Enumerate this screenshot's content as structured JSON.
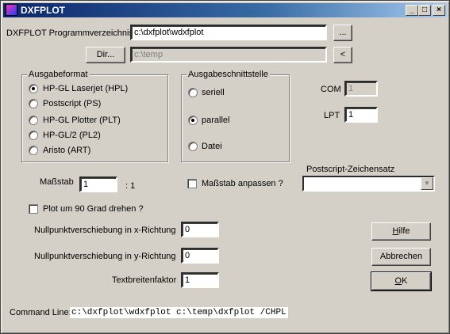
{
  "window": {
    "title": "DXFPLOT",
    "minimize": "_",
    "maximize": "□",
    "close": "×"
  },
  "program_dir": {
    "label": "DXFPLOT Programmverzeichnis",
    "value": "c:\\dxfplot\\wdxfplot",
    "browse": "..."
  },
  "dir": {
    "button": "Dir...",
    "value": "c:\\temp",
    "arrow": "<"
  },
  "output_format": {
    "title": "Ausgabeformat",
    "options": [
      "HP-GL Laserjet (HPL)",
      "Postscript (PS)",
      "HP-GL Plotter (PLT)",
      "HP-GL/2 (PL2)",
      "Aristo (ART)"
    ],
    "selected": 0
  },
  "interface": {
    "title": "Ausgabeschnittstelle",
    "options": [
      "seriell",
      "parallel",
      "Datei"
    ],
    "selected": 1
  },
  "com": {
    "label": "COM",
    "value": "1"
  },
  "lpt": {
    "label": "LPT",
    "value": "1"
  },
  "scale": {
    "label": "Maßstab",
    "value": "1",
    "suffix": ": 1"
  },
  "fit_scale": {
    "label": "Maßstab anpassen ?",
    "checked": false
  },
  "ps_font": {
    "label": "Postscript-Zeichensatz",
    "value": ""
  },
  "rotate": {
    "label": "Plot um 90 Grad drehen ?",
    "checked": false
  },
  "offset_x": {
    "label": "Nullpunktverschiebung in x-Richtung",
    "value": "0"
  },
  "offset_y": {
    "label": "Nullpunktverschiebung in y-Richtung",
    "value": "0"
  },
  "text_width": {
    "label": "Textbreitenfaktor",
    "value": "1"
  },
  "buttons": {
    "help_u": "H",
    "help_rest": "ilfe",
    "cancel": "Abbrechen",
    "ok_u": "O",
    "ok_rest": "K"
  },
  "command_line": {
    "label": "Command Line:",
    "value": "c:\\dxfplot\\wdxfplot c:\\temp\\dxfplot /CHPL"
  }
}
